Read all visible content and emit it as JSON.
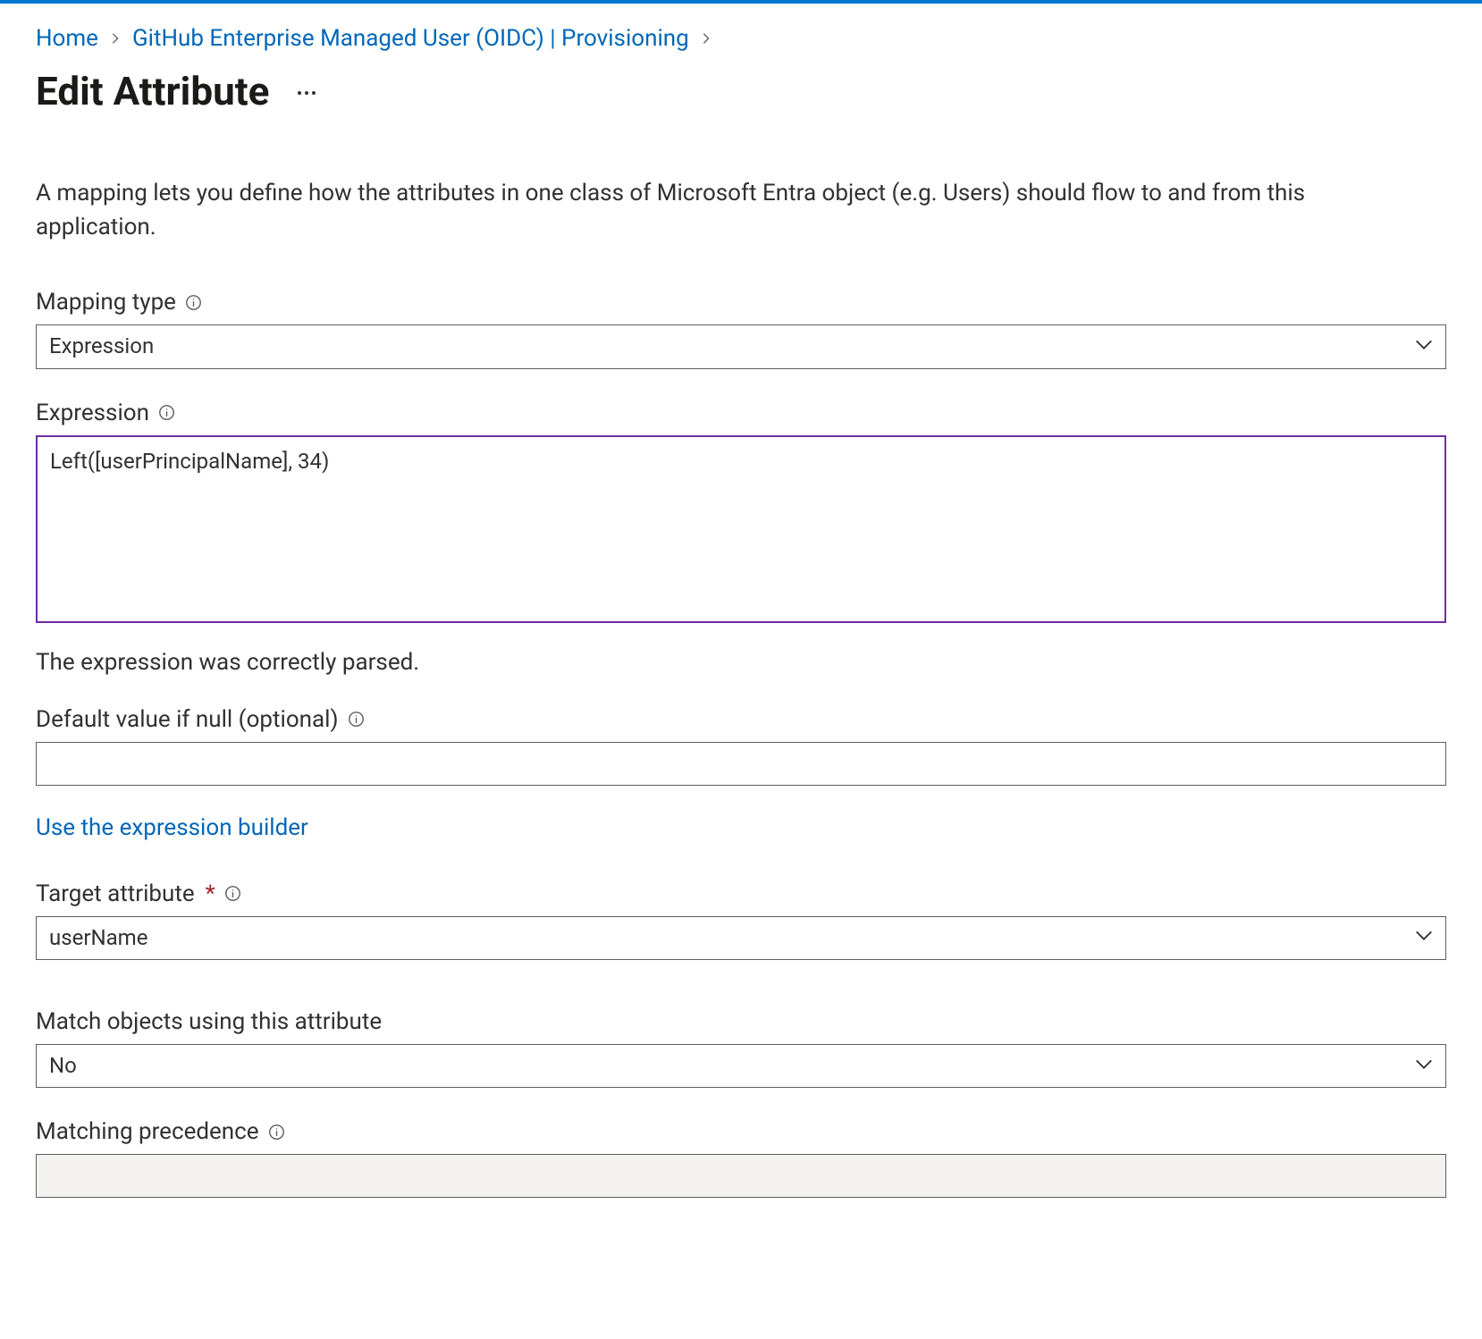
{
  "breadcrumb": {
    "home": "Home",
    "app": "GitHub Enterprise Managed User (OIDC) | Provisioning"
  },
  "title": "Edit Attribute",
  "description": "A mapping lets you define how the attributes in one class of Microsoft Entra object (e.g. Users) should flow to and from this application.",
  "fields": {
    "mapping_type": {
      "label": "Mapping type",
      "value": "Expression"
    },
    "expression": {
      "label": "Expression",
      "value": "Left([userPrincipalName], 34)",
      "status": "The expression was correctly parsed."
    },
    "default_value": {
      "label": "Default value if null (optional)",
      "value": ""
    },
    "builder_link": "Use the expression builder",
    "target_attribute": {
      "label": "Target attribute",
      "value": "userName"
    },
    "match_objects": {
      "label": "Match objects using this attribute",
      "value": "No"
    },
    "matching_precedence": {
      "label": "Matching precedence",
      "value": ""
    }
  }
}
